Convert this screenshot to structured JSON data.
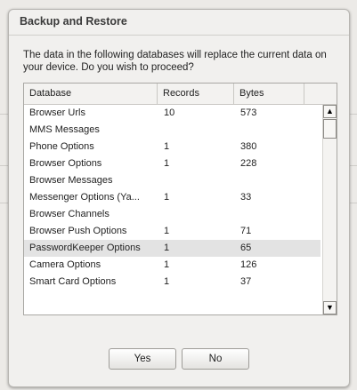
{
  "dialog": {
    "title": "Backup and Restore",
    "message": "The data in the following databases will replace the current data on your device. Do you wish to proceed?"
  },
  "table": {
    "columns": [
      "Database",
      "Records",
      "Bytes"
    ],
    "rows": [
      {
        "database": "Browser Urls",
        "records": "10",
        "bytes": "573"
      },
      {
        "database": "MMS Messages",
        "records": "",
        "bytes": ""
      },
      {
        "database": "Phone Options",
        "records": "1",
        "bytes": "380"
      },
      {
        "database": "Browser Options",
        "records": "1",
        "bytes": "228"
      },
      {
        "database": "Browser Messages",
        "records": "",
        "bytes": ""
      },
      {
        "database": "Messenger Options (Ya...",
        "records": "1",
        "bytes": "33"
      },
      {
        "database": "Browser Channels",
        "records": "",
        "bytes": ""
      },
      {
        "database": "Browser Push Options",
        "records": "1",
        "bytes": "71"
      },
      {
        "database": "PasswordKeeper Options",
        "records": "1",
        "bytes": "65"
      },
      {
        "database": "Camera Options",
        "records": "1",
        "bytes": "126"
      },
      {
        "database": "Smart Card Options",
        "records": "1",
        "bytes": "37"
      }
    ],
    "selected_row": 8
  },
  "scrollbar": {
    "up_glyph": "▲",
    "down_glyph": "▼"
  },
  "buttons": {
    "yes_label": "Yes",
    "no_label": "No"
  }
}
